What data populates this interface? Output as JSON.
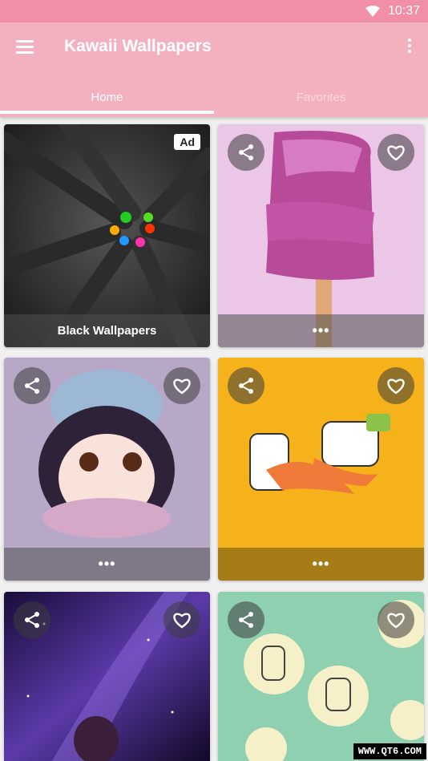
{
  "status": {
    "time": "10:37"
  },
  "appbar": {
    "title": "Kawaii Wallpapers"
  },
  "tabs": [
    {
      "label": "Home",
      "active": true
    },
    {
      "label": "Favorites",
      "active": false
    }
  ],
  "cards": [
    {
      "label": "Black Wallpapers",
      "ad_badge": "Ad"
    },
    {
      "more": "•••"
    },
    {
      "more": "•••"
    },
    {
      "more": "•••"
    }
  ],
  "icons": {
    "menu": "hamburger-icon",
    "more": "overflow-icon",
    "share": "share-icon",
    "heart": "heart-outline-icon",
    "wifi": "wifi-icon"
  },
  "colors": {
    "appbar": "#f3b1bf",
    "statusbar": "#f08fa6"
  },
  "watermark": "WWW.QT6.COM"
}
